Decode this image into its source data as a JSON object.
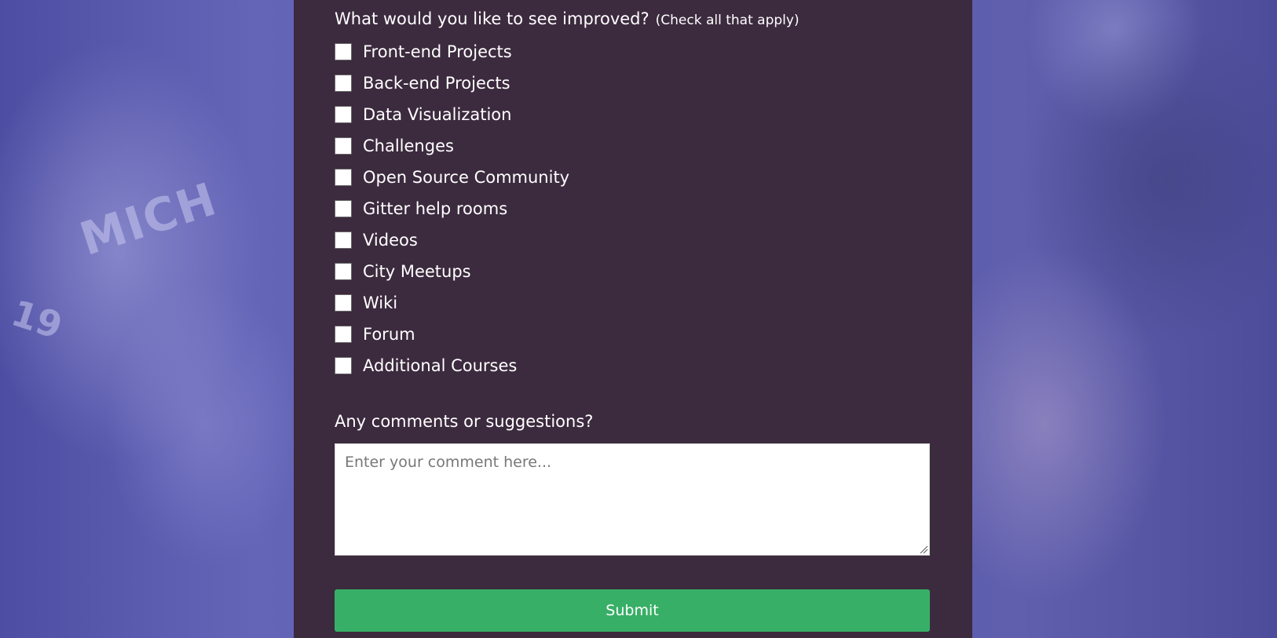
{
  "improvements": {
    "question": "What would you like to see improved?",
    "hint": "(Check all that apply)",
    "options": [
      {
        "label": "Front-end Projects",
        "checked": false
      },
      {
        "label": "Back-end Projects",
        "checked": false
      },
      {
        "label": "Data Visualization",
        "checked": false
      },
      {
        "label": "Challenges",
        "checked": false
      },
      {
        "label": "Open Source Community",
        "checked": false
      },
      {
        "label": "Gitter help rooms",
        "checked": false
      },
      {
        "label": "Videos",
        "checked": false
      },
      {
        "label": "City Meetups",
        "checked": false
      },
      {
        "label": "Wiki",
        "checked": false
      },
      {
        "label": "Forum",
        "checked": false
      },
      {
        "label": "Additional Courses",
        "checked": false
      }
    ]
  },
  "comments": {
    "label": "Any comments or suggestions?",
    "placeholder": "Enter your comment here...",
    "value": ""
  },
  "submit": {
    "label": "Submit"
  },
  "colors": {
    "panel_background": "#3c2a3e",
    "submit_button": "#37af66",
    "page_background": "#5a5aa8"
  }
}
